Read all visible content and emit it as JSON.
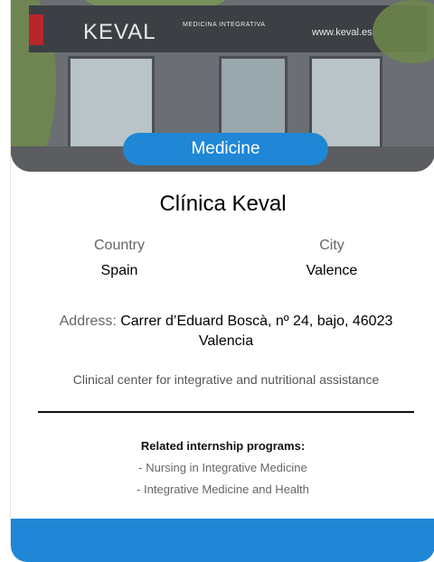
{
  "photo": {
    "sign_brand": "KEVAL",
    "sign_sub": "MEDICINA INTEGRATIVA",
    "sign_web": "www.keval.es"
  },
  "badge": {
    "label": "Medicine"
  },
  "clinic": {
    "name": "Clínica Keval"
  },
  "location": {
    "country_label": "Country",
    "country_value": "Spain",
    "city_label": "City",
    "city_value": "Valence"
  },
  "address": {
    "label": "Address:",
    "value": "Carrer d’Eduard Boscà, nº 24, bajo, 46023 Valencia"
  },
  "description": "Clinical center for integrative and nutritional assistance",
  "related": {
    "heading": "Related internship programs:",
    "programs": [
      "- Nursing in Integrative Medicine",
      "- Integrative Medicine and Health"
    ]
  },
  "colors": {
    "accent": "#1f87d6"
  }
}
